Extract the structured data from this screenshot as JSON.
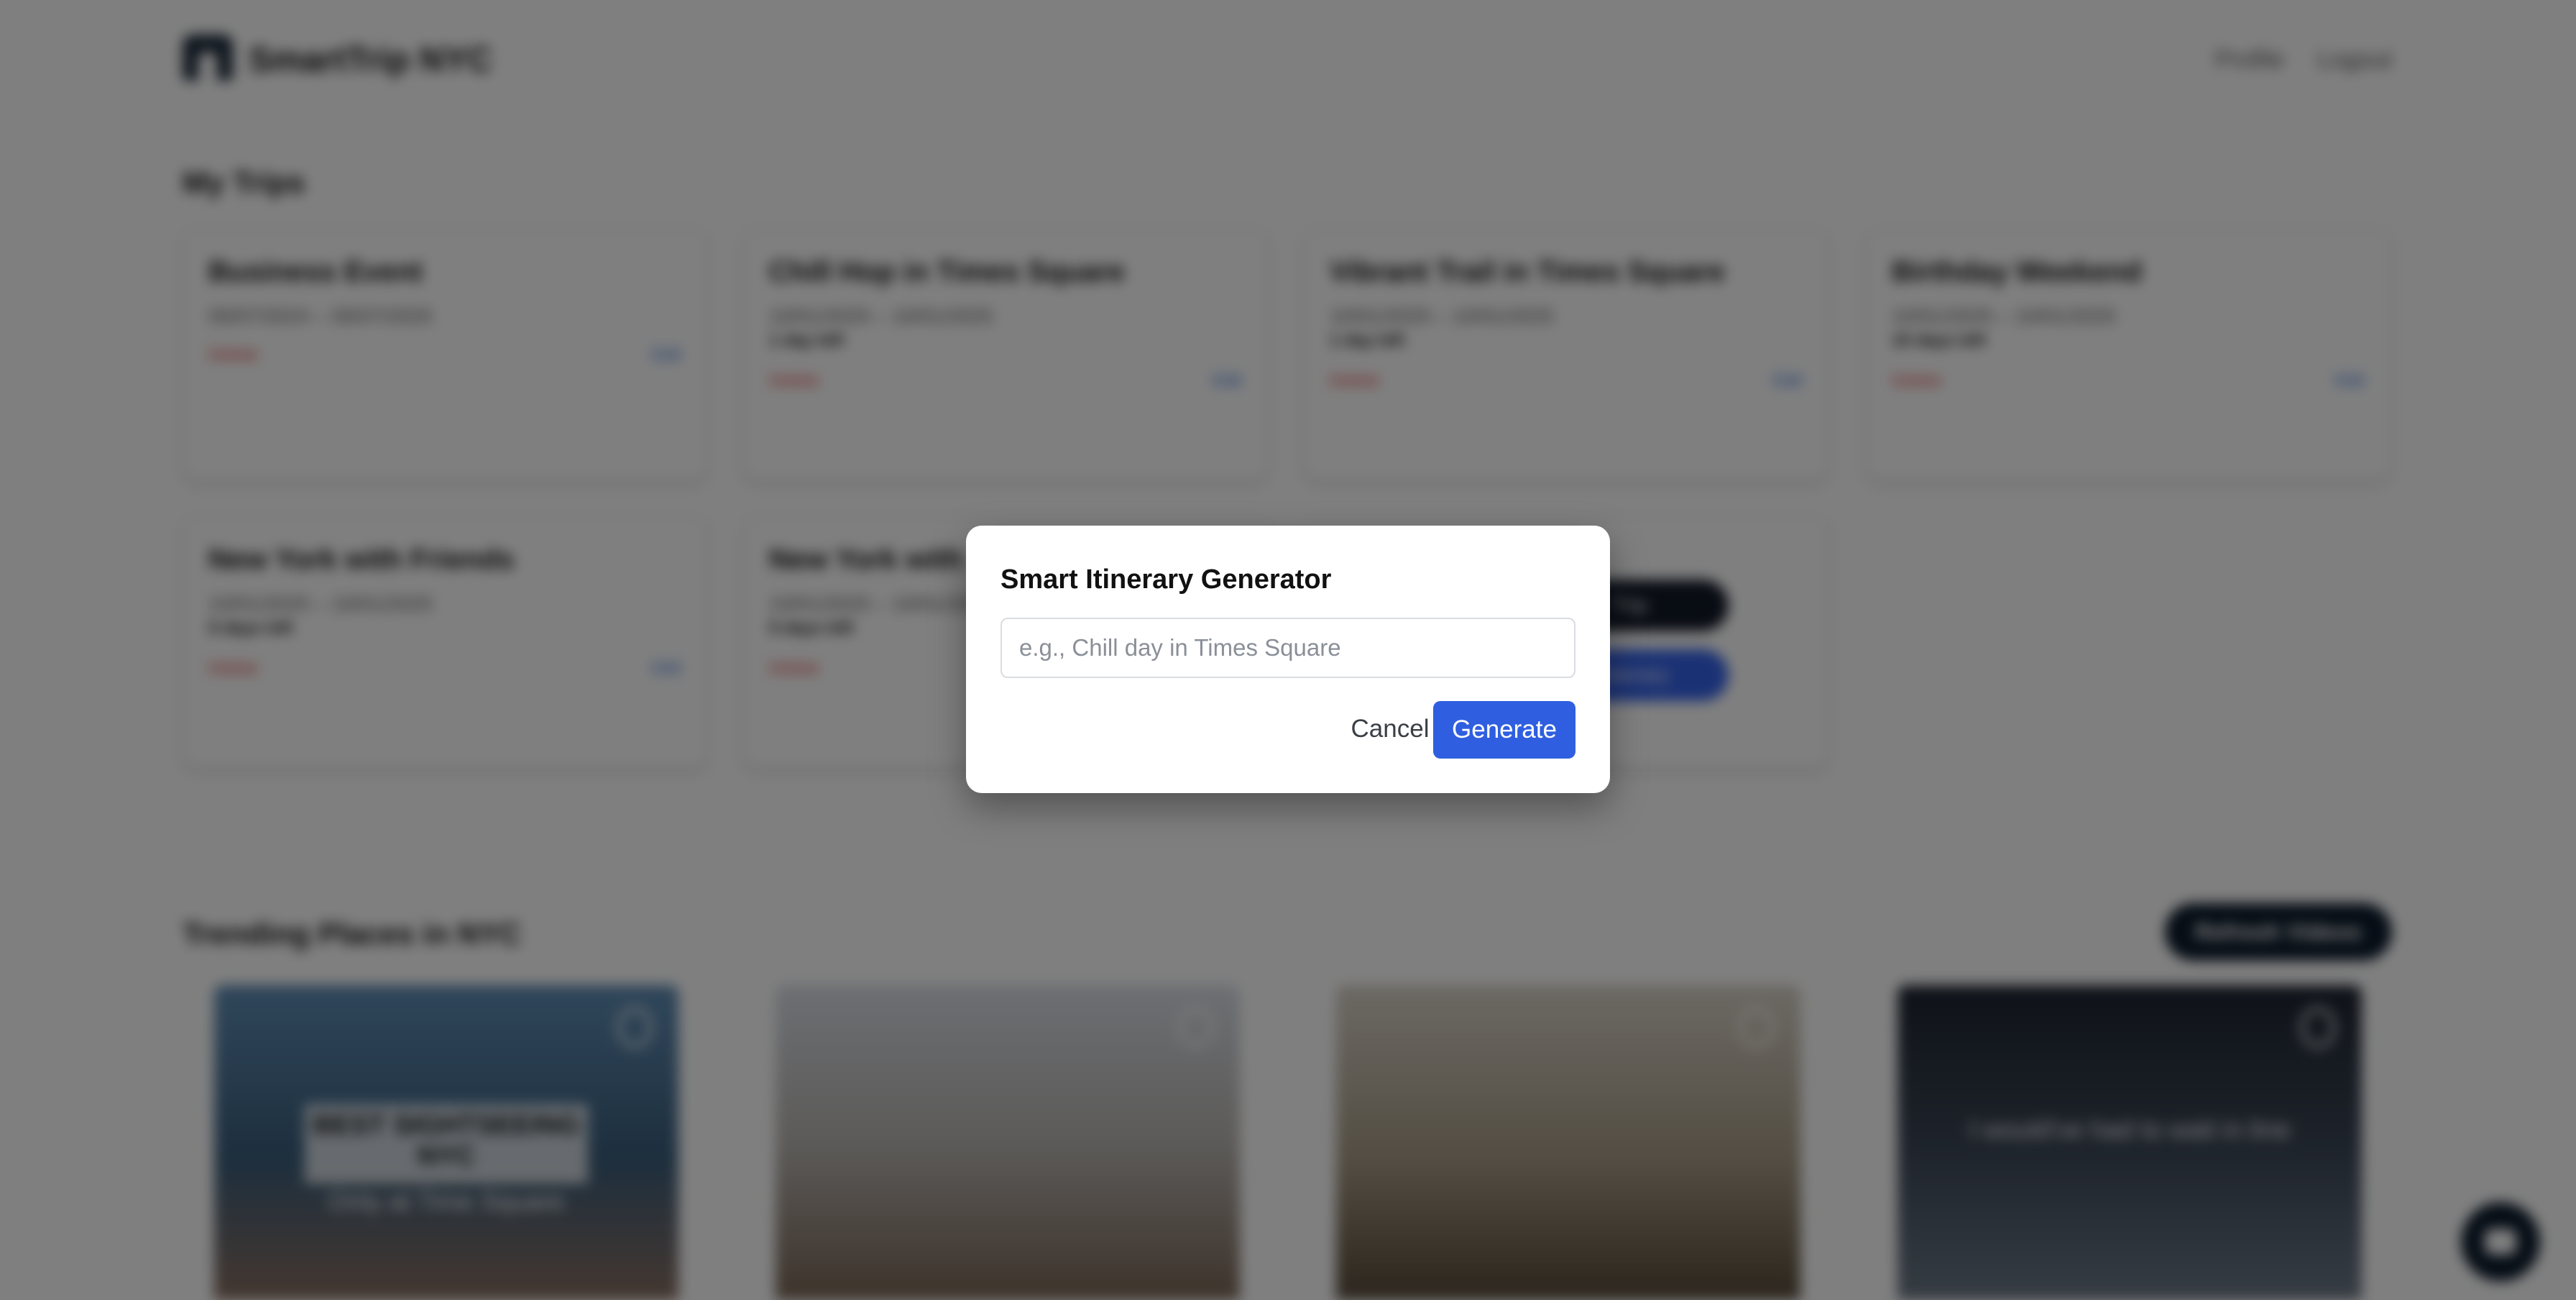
{
  "header": {
    "brand": "SmartTrip NYC",
    "nav": {
      "profile": "Profile",
      "logout": "Logout"
    }
  },
  "my_trips": {
    "title": "My Trips",
    "trips": [
      {
        "title": "Business Event",
        "dates": "05/07/2024 – 05/07/2025",
        "days_left": "",
        "delete": "Delete",
        "edit": "Edit"
      },
      {
        "title": "Chill Hop in Times Square",
        "dates": "10/01/2025 – 10/01/2025",
        "days_left": "1 day left",
        "delete": "Delete",
        "edit": "Edit"
      },
      {
        "title": "Vibrant Trail in Times Square",
        "dates": "10/01/2025 – 10/01/2025",
        "days_left": "1 day left",
        "delete": "Delete",
        "edit": "Edit"
      },
      {
        "title": "Birthday Weekend",
        "dates": "10/01/2025 – 10/01/2025",
        "days_left": "10 days left",
        "delete": "Delete",
        "edit": "Edit"
      },
      {
        "title": "New York with Friends",
        "dates": "10/01/2025 – 10/01/2025",
        "days_left": "5 days left",
        "delete": "Delete",
        "edit": "Edit"
      },
      {
        "title": "New York with",
        "dates": "10/01/2025 – 10/01/2025",
        "days_left": "5 days left",
        "delete": "Delete",
        "edit": "Edit"
      }
    ],
    "new_trip_button": "Trip",
    "smart_button": "Itinerary"
  },
  "trending": {
    "title": "Trending Places in NYC",
    "refresh_button": "Refresh Videos",
    "videos": [
      {
        "banner": "BEST SIGHTSEEING NYC",
        "caption": "Only at Time Square"
      },
      {
        "banner": "",
        "caption": ""
      },
      {
        "banner": "",
        "caption": ""
      },
      {
        "banner": "",
        "caption": "I would've had to wait in line"
      }
    ]
  },
  "modal": {
    "title": "Smart Itinerary Generator",
    "input_placeholder": "e.g., Chill day in Times Square",
    "input_value": "",
    "cancel_label": "Cancel",
    "generate_label": "Generate"
  },
  "colors": {
    "primary": "#2f5fe0",
    "dark": "#0b1a2b",
    "delete": "#e03131",
    "edit": "#2f6fdc",
    "backdrop": "rgba(0,0,0,0.5)"
  },
  "icons": {
    "logo": "liberty-logo-icon",
    "chat": "chat-bubble-icon",
    "video_brand": "tiktok-icon"
  }
}
